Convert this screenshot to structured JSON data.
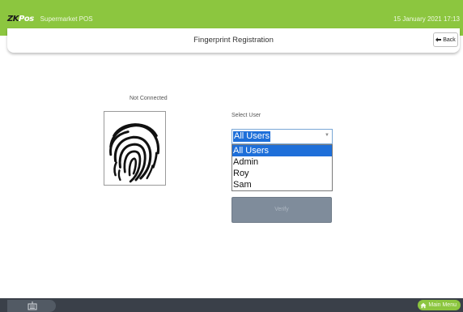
{
  "topbar": {
    "logo_zk": "ZK",
    "logo_pos": "Pos",
    "app_name": "Supermarket POS",
    "datetime": "15 January 2021 17:13"
  },
  "header": {
    "title": "Fingerprint Registration",
    "back_label": "Back"
  },
  "scanner": {
    "status": "Not Connected",
    "icon": "fingerprint-icon"
  },
  "user_select": {
    "label": "Select User",
    "selected": "All Users",
    "options": [
      "All Users",
      "Admin",
      "Roy",
      "Sam"
    ]
  },
  "verify": {
    "label": "Verify"
  },
  "footer": {
    "keyboard_icon": "keyboard-icon",
    "main_menu_label": "Main Menu",
    "home_icon": "home-icon"
  },
  "colors": {
    "brand_green": "#8cc63f",
    "footer_dark": "#3a4049",
    "select_blue": "#1e6fd9",
    "verify_gray": "#7f8c9b"
  }
}
